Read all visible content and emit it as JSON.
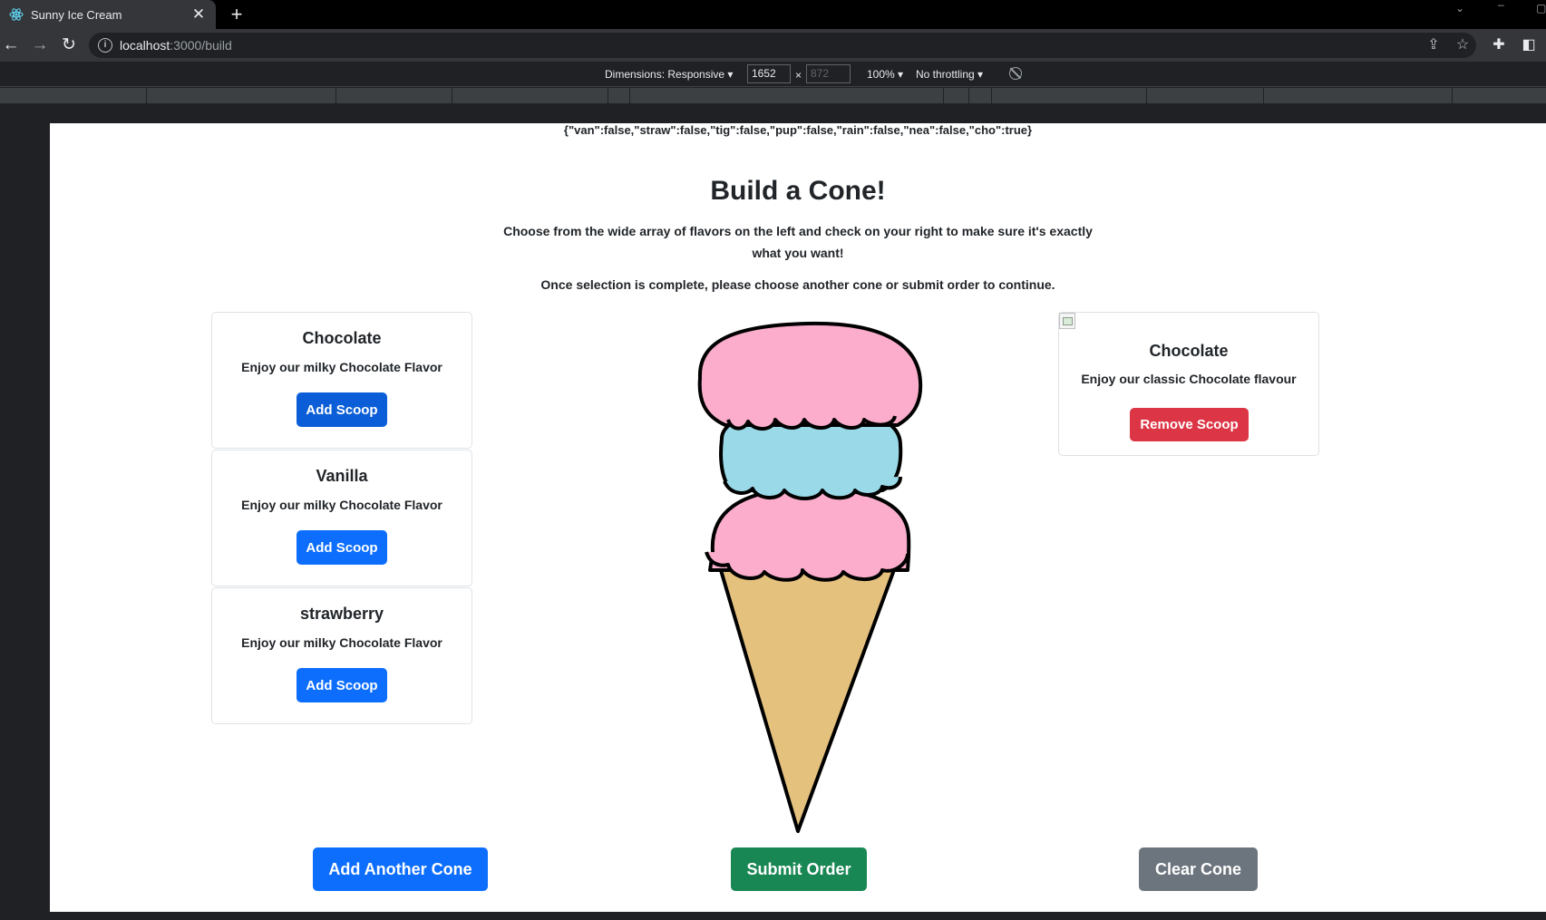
{
  "browser": {
    "tab_title": "Sunny Ice Cream",
    "url_host": "localhost",
    "url_path": ":3000/build",
    "tab_icon": "react-icon",
    "toolbar_icons": [
      "share-icon",
      "star-icon",
      "extensions-icon",
      "sidepanel-icon"
    ]
  },
  "devtools": {
    "dimensions_label": "Dimensions: Responsive",
    "width_value": "1652",
    "height_value": "872",
    "times": "×",
    "zoom": "100%",
    "throttling": "No throttling"
  },
  "page": {
    "state_json": "{\"van\":false,\"straw\":false,\"tig\":false,\"pup\":false,\"rain\":false,\"nea\":false,\"cho\":true}",
    "title": "Build a Cone!",
    "subtitle": "Choose from the wide array of flavors on the left and check on your right to make sure it's exactly what you want!",
    "subtitle2": "Once selection is complete, please choose another cone or submit order to continue.",
    "flavors": [
      {
        "name": "Chocolate",
        "description": "Enjoy our milky Chocolate Flavor",
        "button": "Add Scoop"
      },
      {
        "name": "Vanilla",
        "description": "Enjoy our milky Chocolate Flavor",
        "button": "Add Scoop"
      },
      {
        "name": "strawberry",
        "description": "Enjoy our milky Chocolate Flavor",
        "button": "Add Scoop"
      }
    ],
    "selected": [
      {
        "name": "Chocolate",
        "description": "Enjoy our classic Chocolate flavour",
        "button": "Remove Scoop"
      }
    ],
    "buttons": {
      "add_another": "Add Another Cone",
      "submit": "Submit Order",
      "clear": "Clear Cone"
    }
  },
  "colors": {
    "primary": "#0d6efd",
    "success": "#198754",
    "danger": "#dc3545",
    "secondary": "#6c757d",
    "scoop_pink": "#fbadcb",
    "scoop_blue": "#99d9e8",
    "cone": "#e5c17e"
  }
}
